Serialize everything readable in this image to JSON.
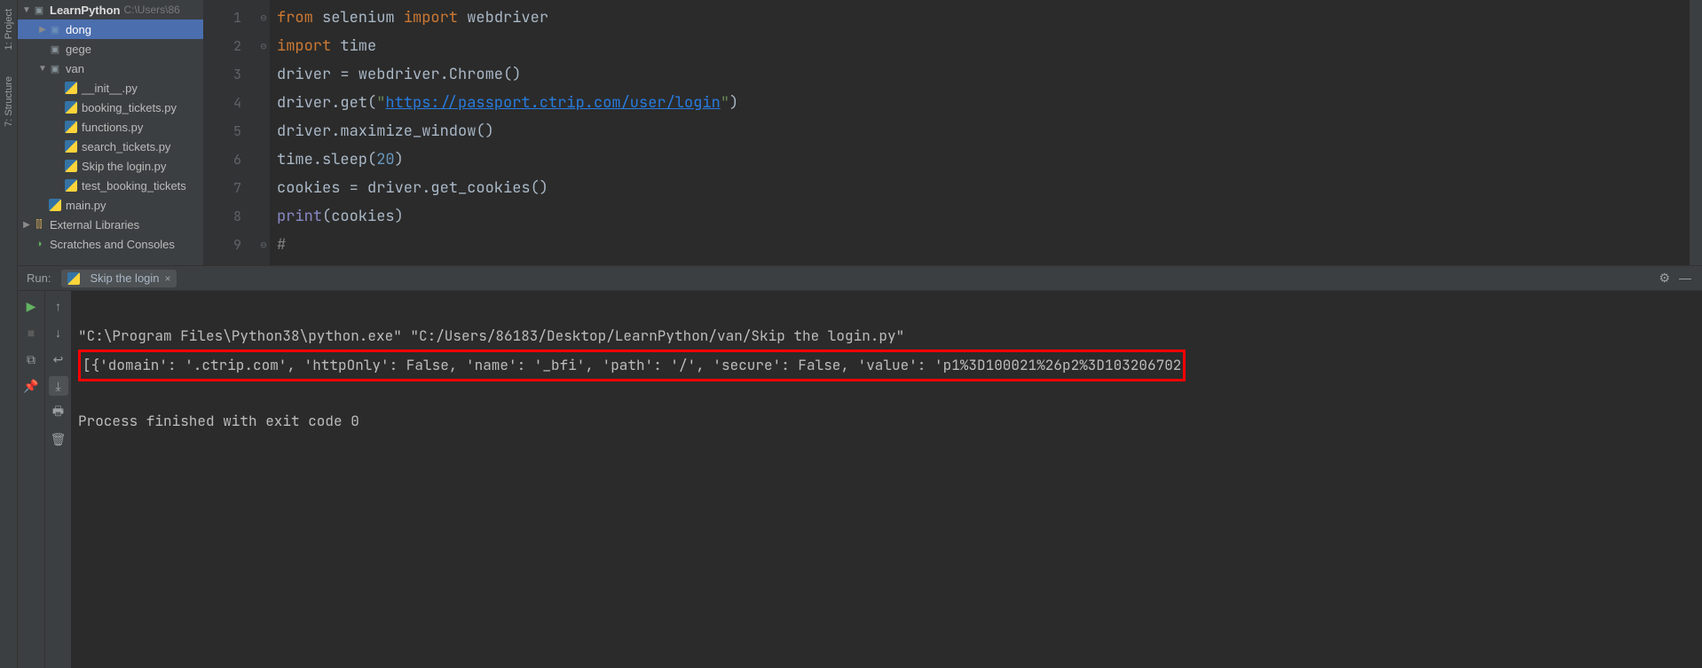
{
  "sidebar_labels": {
    "project": "1: Project",
    "structure": "7: Structure"
  },
  "tree": {
    "root": {
      "label": "LearnPython",
      "path": "C:\\Users\\86"
    },
    "items": [
      {
        "label": "dong",
        "type": "folder-hl",
        "indent": 1,
        "chev": "▶",
        "selected": true
      },
      {
        "label": "gege",
        "type": "folder",
        "indent": 1,
        "chev": ""
      },
      {
        "label": "van",
        "type": "folder",
        "indent": 1,
        "chev": "▼"
      },
      {
        "label": "__init__.py",
        "type": "py",
        "indent": 2
      },
      {
        "label": "booking_tickets.py",
        "type": "py",
        "indent": 2
      },
      {
        "label": "functions.py",
        "type": "py",
        "indent": 2
      },
      {
        "label": "search_tickets.py",
        "type": "py",
        "indent": 2
      },
      {
        "label": "Skip the login.py",
        "type": "py",
        "indent": 2
      },
      {
        "label": "test_booking_tickets",
        "type": "py",
        "indent": 2
      },
      {
        "label": "main.py",
        "type": "py",
        "indent": 1
      }
    ],
    "external_libs": "External Libraries",
    "scratches": "Scratches and Consoles"
  },
  "editor": {
    "line_numbers": [
      "1",
      "2",
      "3",
      "4",
      "5",
      "6",
      "7",
      "8",
      "9"
    ],
    "code_lines": [
      {
        "tokens": [
          {
            "t": "from ",
            "c": "kw"
          },
          {
            "t": "selenium ",
            "c": ""
          },
          {
            "t": "import ",
            "c": "kw"
          },
          {
            "t": "webdriver",
            "c": ""
          }
        ]
      },
      {
        "tokens": [
          {
            "t": "import ",
            "c": "kw"
          },
          {
            "t": "time",
            "c": ""
          }
        ]
      },
      {
        "tokens": [
          {
            "t": "driver = webdriver.Chrome()",
            "c": ""
          }
        ]
      },
      {
        "tokens": [
          {
            "t": "driver.get(",
            "c": ""
          },
          {
            "t": "\"",
            "c": "str"
          },
          {
            "t": "https://passport.ctrip.com/user/login",
            "c": "str url"
          },
          {
            "t": "\"",
            "c": "str"
          },
          {
            "t": ")",
            "c": ""
          }
        ]
      },
      {
        "tokens": [
          {
            "t": "driver.maximize_window()",
            "c": ""
          }
        ]
      },
      {
        "tokens": [
          {
            "t": "time.sleep(",
            "c": ""
          },
          {
            "t": "20",
            "c": "num"
          },
          {
            "t": ")",
            "c": ""
          }
        ]
      },
      {
        "tokens": [
          {
            "t": "cookies = driver.get_cookies()",
            "c": ""
          }
        ]
      },
      {
        "tokens": [
          {
            "t": "print",
            "c": "builtin"
          },
          {
            "t": "(cookies)",
            "c": ""
          }
        ]
      },
      {
        "tokens": [
          {
            "t": "#",
            "c": "cmt"
          }
        ]
      }
    ]
  },
  "run": {
    "header_label": "Run:",
    "tab_name": "Skip the login",
    "console_lines": {
      "l1": "\"C:\\Program Files\\Python38\\python.exe\" \"C:/Users/86183/Desktop/LearnPython/van/Skip the login.py\"",
      "l2": "[{'domain': '.ctrip.com', 'httpOnly': False, 'name': '_bfi', 'path': '/', 'secure': False, 'value': 'p1%3D100021%26p2%3D103206702",
      "l3": "",
      "l4": "Process finished with exit code 0"
    }
  }
}
